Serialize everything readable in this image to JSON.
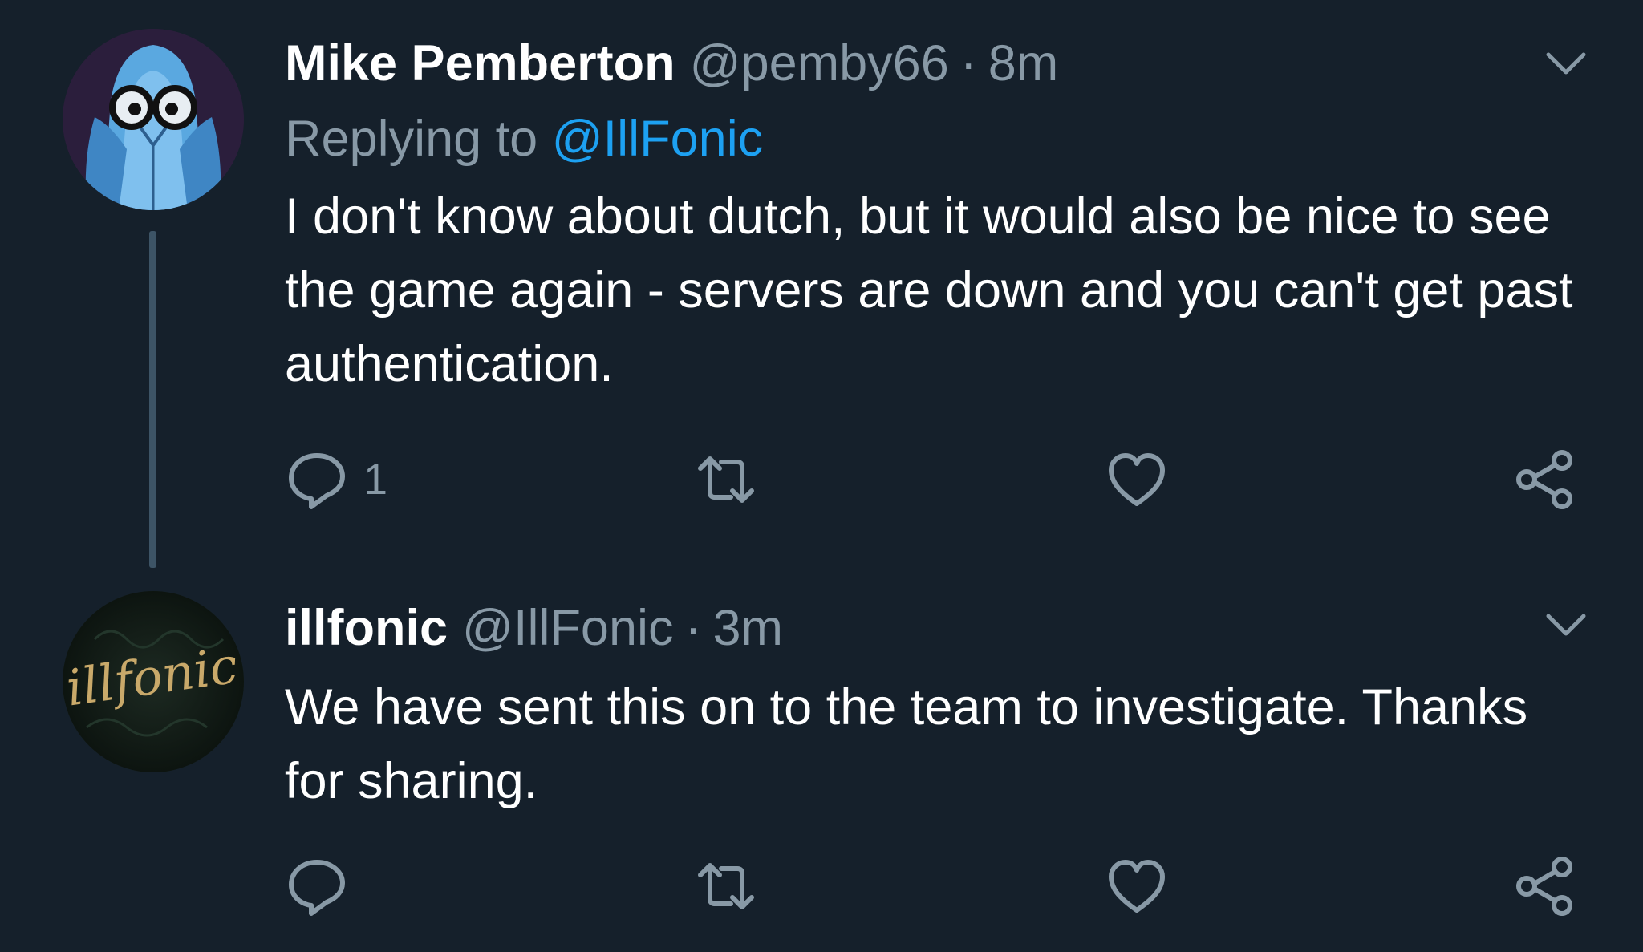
{
  "tweets": [
    {
      "display_name": "Mike Pemberton",
      "handle": "@pemby66",
      "separator": "·",
      "time": "8m",
      "replying_prefix": "Replying to",
      "replying_handle": "@IllFonic",
      "text": "I don't know about dutch, but it would also be nice to see the game again - servers are down and you can't get past authentication.",
      "reply_count": "1",
      "avatar_icon": "ghost-with-glasses-avatar"
    },
    {
      "display_name": "illfonic",
      "handle": "@IllFonic",
      "separator": "·",
      "time": "3m",
      "text": "We have sent this on to the team to investigate. Thanks for sharing.",
      "reply_count": "",
      "avatar_icon": "illfonic-logo-avatar",
      "avatar_logo_text": "illfonic"
    }
  ],
  "colors": {
    "background": "#15202b",
    "secondary_text": "#8899a6",
    "link": "#1da1f2",
    "thread_line": "#3d5466"
  },
  "icons": [
    "reply-icon",
    "retweet-icon",
    "like-icon",
    "share-icon",
    "chevron-down-icon"
  ]
}
